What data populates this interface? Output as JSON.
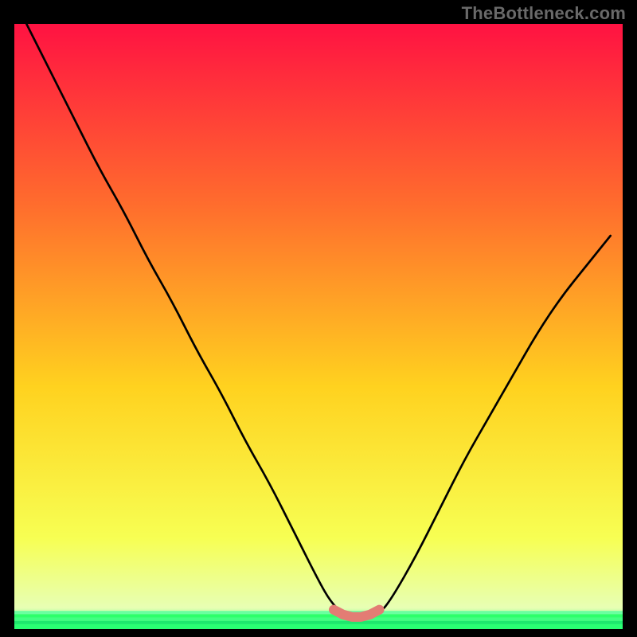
{
  "watermark": "TheBottleneck.com",
  "palette": {
    "black": "#000000",
    "line": "#000000",
    "marker": "#e37c74",
    "grad_top": "#ff1242",
    "grad_upper": "#ff6d2d",
    "grad_mid": "#ffd21f",
    "grad_lower": "#f7ff53",
    "grad_base": "#e7ffb4",
    "green1": "#2dff6b",
    "green2": "#1ee86d",
    "green3": "#41ff82",
    "green4": "#2aff73",
    "green5": "#6affa0"
  },
  "chart_data": {
    "type": "line",
    "title": "",
    "xlabel": "",
    "ylabel": "",
    "xlim": [
      0,
      100
    ],
    "ylim": [
      0,
      100
    ],
    "series": [
      {
        "name": "curve",
        "x": [
          2,
          6,
          10,
          14,
          18,
          22,
          26,
          30,
          34,
          38,
          42,
          46,
          50,
          52,
          54,
          56,
          58,
          60,
          62,
          66,
          70,
          74,
          78,
          82,
          86,
          90,
          94,
          98
        ],
        "values": [
          100,
          92,
          84,
          76,
          69,
          61,
          54,
          46,
          39,
          31,
          24,
          16,
          8,
          4.5,
          2.5,
          1.8,
          1.8,
          2.5,
          5,
          12,
          20,
          28,
          35,
          42,
          49,
          55,
          60,
          65
        ]
      }
    ],
    "trough_markers": {
      "x": [
        52.5,
        54,
        55.5,
        57,
        58.5,
        60
      ],
      "values": [
        3.2,
        2.4,
        2.0,
        2.0,
        2.4,
        3.2
      ]
    },
    "green_band_fraction_from_bottom": 0.03
  }
}
